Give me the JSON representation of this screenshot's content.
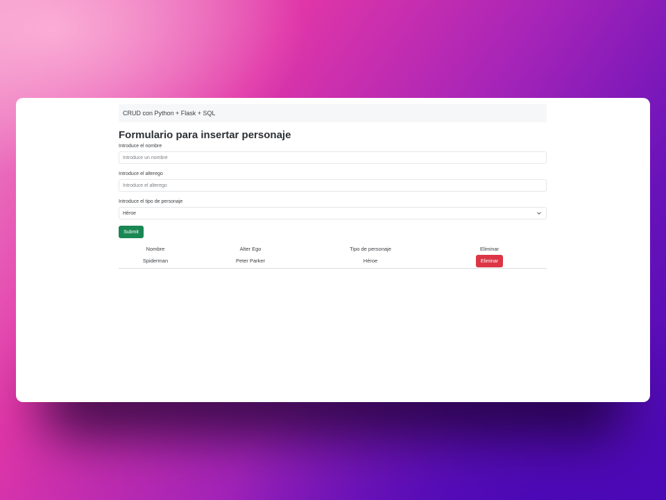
{
  "navbar": {
    "brand": "CRUD con Python + Flask + SQL"
  },
  "form": {
    "title": "Formulario para insertar personaje",
    "name": {
      "label": "Introduce el nombre",
      "placeholder": "Introduce un nombre"
    },
    "alterego": {
      "label": "Introduce el alterego",
      "placeholder": "Introduce el alterego"
    },
    "type": {
      "label": "Introduce el tipo de personaje",
      "selected": "Héroe"
    },
    "submit_label": "Submit"
  },
  "table": {
    "headers": [
      "Nombre",
      "Alter Ego",
      "Tipo de personaje",
      "Eliminar"
    ],
    "rows": [
      {
        "nombre": "Spiderman",
        "alter_ego": "Peter Parker",
        "tipo": "Héroe",
        "action_label": "Eliminar"
      }
    ]
  },
  "colors": {
    "submit": "#198754",
    "delete": "#dc3545",
    "navbar_bg": "#f6f7f8"
  },
  "icons": {
    "select_arrow": "chevron-down-icon"
  }
}
